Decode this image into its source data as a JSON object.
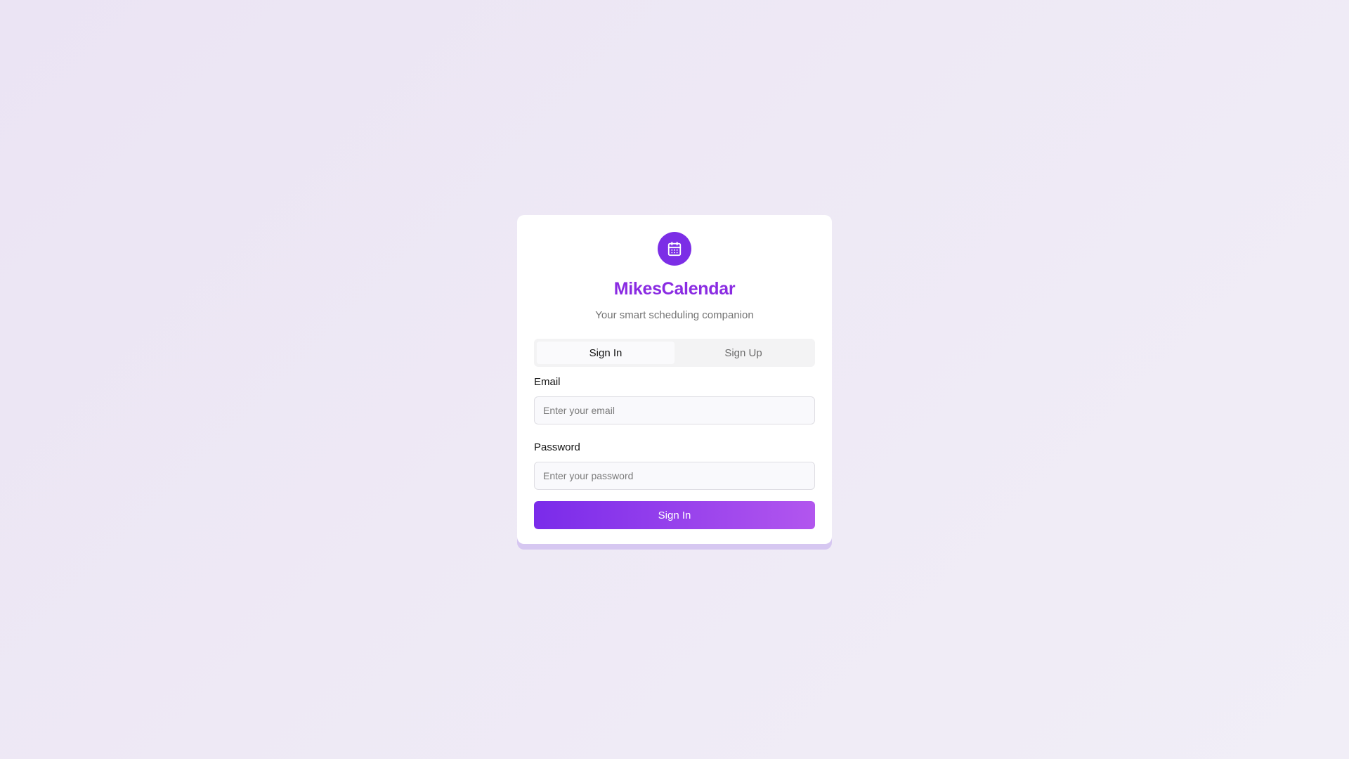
{
  "app": {
    "title": "MikesCalendar",
    "subtitle": "Your smart scheduling companion",
    "logo_icon": "calendar-icon"
  },
  "tabs": [
    {
      "label": "Sign In",
      "active": true
    },
    {
      "label": "Sign Up",
      "active": false
    }
  ],
  "form": {
    "email": {
      "label": "Email",
      "placeholder": "Enter your email",
      "value": ""
    },
    "password": {
      "label": "Password",
      "placeholder": "Enter your password",
      "value": ""
    },
    "submit_label": "Sign In"
  },
  "colors": {
    "accent": "#7c2ee6",
    "title": "#8a2be2",
    "button_gradient_start": "#7a2bea",
    "button_gradient_end": "#b256ee",
    "background": "#ede7f5"
  }
}
